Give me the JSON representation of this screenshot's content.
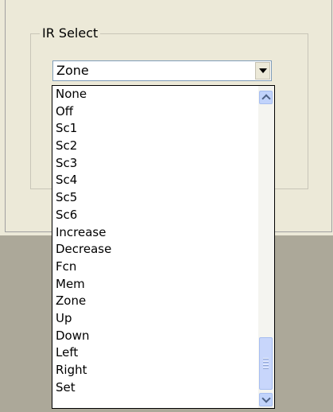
{
  "group": {
    "title": "IR Select"
  },
  "combo": {
    "selected": "Zone"
  },
  "dropdown": {
    "items": [
      "None",
      "Off",
      "Sc1",
      "Sc2",
      "Sc3",
      "Sc4",
      "Sc5",
      "Sc6",
      "Increase",
      "Decrease",
      "Fcn",
      "Mem",
      "Zone",
      "Up",
      "Down",
      "Left",
      "Right",
      "Set"
    ]
  }
}
